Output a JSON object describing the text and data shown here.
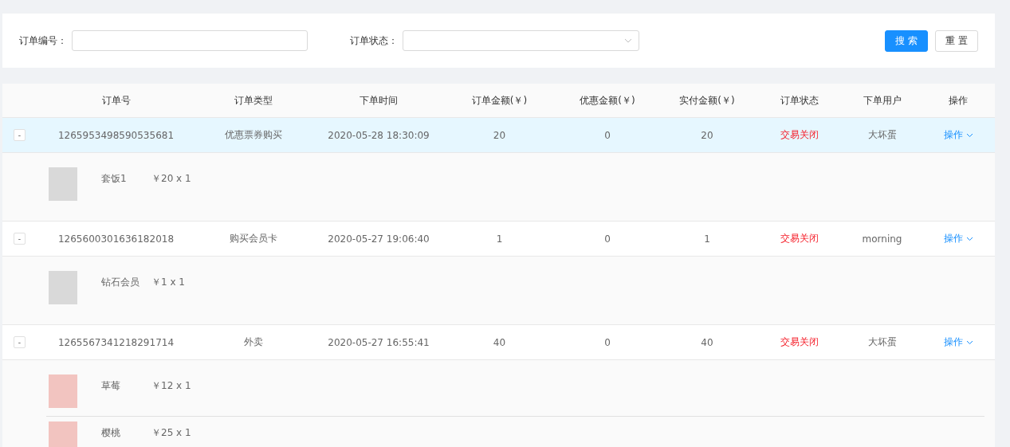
{
  "search_form": {
    "order_no": {
      "label": "订单编号："
    },
    "status": {
      "label": "订单状态："
    },
    "buttons": [
      {
        "kind": "primary",
        "label": "搜 索"
      },
      {
        "kind": "default",
        "label": "重 置"
      }
    ]
  },
  "table": {
    "columns": [
      "订单号",
      "订单类型",
      "下单时间",
      "订单金额(￥)",
      "优惠金额(￥)",
      "实付金额(￥)",
      "订单状态",
      "下单用户",
      "操作"
    ],
    "rows": [
      {
        "selected": true,
        "expanded": true,
        "expand_button": "-",
        "order_no": "1265953498590535681",
        "type": "优惠票券购买",
        "time": "2020-05-28 18:30:09",
        "amount": "20",
        "discount": "0",
        "paid": "20",
        "status": "交易关闭",
        "user": "大坏蛋",
        "action": "操作",
        "items": [
          {
            "name": "套饭1",
            "price": "￥20 x 1"
          }
        ]
      },
      {
        "selected": false,
        "expanded": true,
        "expand_button": "-",
        "order_no": "1265600301636182018",
        "type": "购买会员卡",
        "time": "2020-05-27 19:06:40",
        "amount": "1",
        "discount": "0",
        "paid": "1",
        "status": "交易关闭",
        "user": "morning",
        "action": "操作",
        "items": [
          {
            "name": "钻石会员",
            "price": "￥1 x 1"
          }
        ]
      },
      {
        "selected": false,
        "expanded": true,
        "expand_button": "-",
        "order_no": "1265567341218291714",
        "type": "外卖",
        "time": "2020-05-27 16:55:41",
        "amount": "40",
        "discount": "0",
        "paid": "40",
        "status": "交易关闭",
        "user": "大坏蛋",
        "action": "操作",
        "items": [
          {
            "name": "草莓",
            "price": "￥12 x 1"
          },
          {
            "name": "樱桃",
            "price": "￥25 x 1"
          }
        ]
      }
    ]
  }
}
